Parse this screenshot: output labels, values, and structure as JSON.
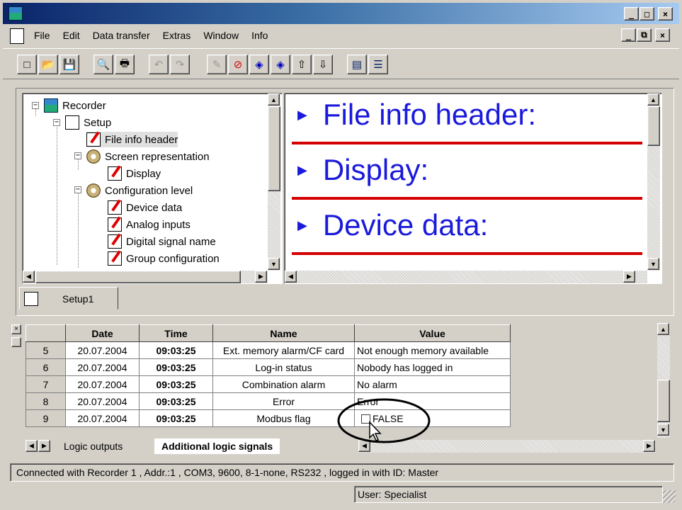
{
  "window": {
    "minimize": "_",
    "maximize": "□",
    "close": "×",
    "restore": "ð"
  },
  "menu": [
    "File",
    "Edit",
    "Data transfer",
    "Extras",
    "Window",
    "Info"
  ],
  "toolbar": [
    {
      "name": "new",
      "glyph": "□"
    },
    {
      "name": "open",
      "glyph": "📂"
    },
    {
      "name": "save",
      "glyph": "💾"
    },
    {
      "name": "print-preview",
      "glyph": "🔍"
    },
    {
      "name": "print",
      "glyph": "🖶"
    },
    {
      "name": "undo",
      "glyph": "↶"
    },
    {
      "name": "redo",
      "glyph": "↷"
    },
    {
      "name": "edit",
      "glyph": "✎"
    },
    {
      "name": "stop",
      "glyph": "⊘"
    },
    {
      "name": "nav-1",
      "glyph": "◈"
    },
    {
      "name": "nav-2",
      "glyph": "◈"
    },
    {
      "name": "upload",
      "glyph": "⇧"
    },
    {
      "name": "download",
      "glyph": "⇩"
    },
    {
      "name": "cascade",
      "glyph": "▤"
    },
    {
      "name": "tile",
      "glyph": "☰"
    }
  ],
  "tree": {
    "items": [
      {
        "label": "Recorder",
        "icon": "recorder-icon"
      },
      {
        "label": "Setup",
        "icon": "setup-icon"
      },
      {
        "label": "File info header",
        "icon": "document-icon"
      },
      {
        "label": "Screen representation",
        "icon": "gear-icon"
      },
      {
        "label": "Display",
        "icon": "document-icon"
      },
      {
        "label": "Configuration level",
        "icon": "gear-icon"
      },
      {
        "label": "Device data",
        "icon": "document-icon"
      },
      {
        "label": "Analog inputs",
        "icon": "document-icon"
      },
      {
        "label": "Digital signal name",
        "icon": "document-icon"
      },
      {
        "label": "Group configuration",
        "icon": "document-icon"
      }
    ]
  },
  "preview": {
    "headings": [
      "File info header:",
      "Display:",
      "Device data:"
    ]
  },
  "doc_tab": {
    "label": "Setup1"
  },
  "grid": {
    "headers": [
      "Date",
      "Time",
      "Name",
      "Value"
    ],
    "rows": [
      {
        "num": "5",
        "date": "20.07.2004",
        "time": "09:03:25",
        "name": "Ext. memory alarm/CF card",
        "value": "Not enough memory available"
      },
      {
        "num": "6",
        "date": "20.07.2004",
        "time": "09:03:25",
        "name": "Log-in status",
        "value": "Nobody has logged in"
      },
      {
        "num": "7",
        "date": "20.07.2004",
        "time": "09:03:25",
        "name": "Combination alarm",
        "value": "No alarm"
      },
      {
        "num": "8",
        "date": "20.07.2004",
        "time": "09:03:25",
        "name": "Error",
        "value": "Error"
      },
      {
        "num": "9",
        "date": "20.07.2004",
        "time": "09:03:25",
        "name": "Modbus flag",
        "value": "FALSE"
      }
    ],
    "tabs": [
      "Logic outputs",
      "Additional logic signals"
    ]
  },
  "status": {
    "connection": "Connected with Recorder 1 , Addr.:1 , COM3, 9600, 8-1-none, RS232 , logged in with ID: Master",
    "user": "User: Specialist"
  },
  "colors": {
    "heading": "#1a1adc",
    "rule": "#d40000",
    "title_start": "#0a246a"
  }
}
